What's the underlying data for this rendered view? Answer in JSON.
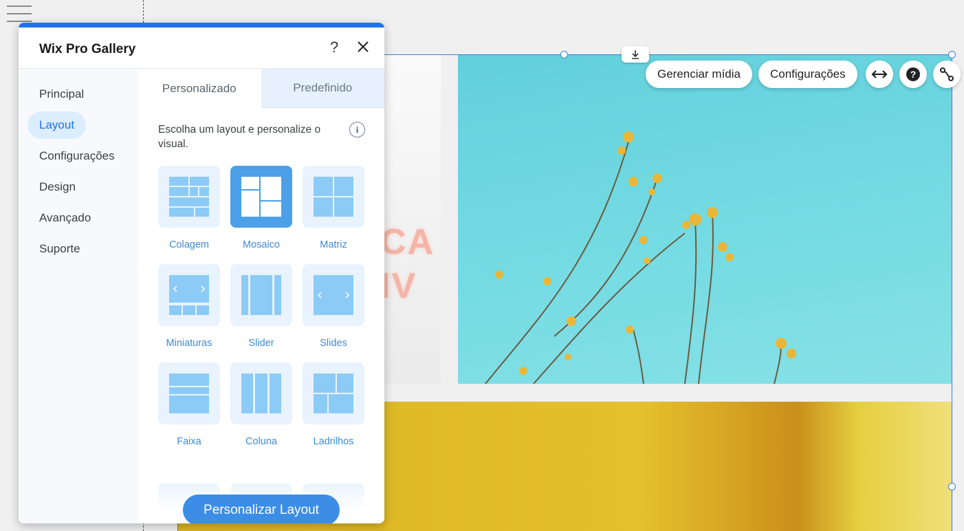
{
  "toolbar": {
    "manage_media": "Gerenciar mídia",
    "settings": "Configurações",
    "stretch_icon": "stretch-icon",
    "help_icon": "question-icon",
    "connect_icon": "connect-icon",
    "download_icon": "download-icon"
  },
  "panel": {
    "title": "Wix Pro Gallery",
    "help": "?",
    "sidebar": {
      "items": [
        {
          "label": "Principal"
        },
        {
          "label": "Layout",
          "active": true
        },
        {
          "label": "Configurações"
        },
        {
          "label": "Design"
        },
        {
          "label": "Avançado"
        },
        {
          "label": "Suporte"
        }
      ]
    },
    "tabs": [
      {
        "label": "Personalizado",
        "active": true
      },
      {
        "label": "Predefinido"
      }
    ],
    "hint": "Escolha um layout e personalize o visual.",
    "info": "i",
    "layouts": [
      {
        "label": "Colagem",
        "icon": "collage-layout-icon"
      },
      {
        "label": "Mosaico",
        "icon": "mosaic-layout-icon",
        "selected": true
      },
      {
        "label": "Matriz",
        "icon": "grid-layout-icon"
      },
      {
        "label": "Miniaturas",
        "icon": "thumbnails-layout-icon"
      },
      {
        "label": "Slider",
        "icon": "slider-layout-icon"
      },
      {
        "label": "Slides",
        "icon": "slides-layout-icon"
      },
      {
        "label": "Faixa",
        "icon": "strip-layout-icon"
      },
      {
        "label": "Coluna",
        "icon": "column-layout-icon"
      },
      {
        "label": "Ladrilhos",
        "icon": "tiles-layout-icon"
      }
    ],
    "cta": "Personalizar Layout"
  },
  "colors": {
    "accent": "#1e72f0",
    "tile_bg": "#e8f3fe",
    "tile_selected": "#4ba0e8",
    "icon_blue": "#8ccbf5"
  }
}
